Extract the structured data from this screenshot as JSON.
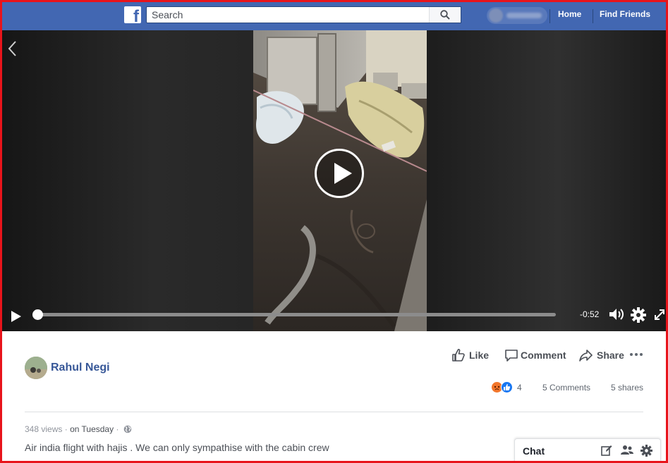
{
  "header": {
    "search_placeholder": "Search",
    "nav": {
      "home": "Home",
      "find_friends": "Find Friends"
    }
  },
  "video": {
    "time_remaining": "-0:52",
    "progress": 0
  },
  "post": {
    "author": "Rahul Negi",
    "actions": {
      "like": "Like",
      "comment": "Comment",
      "share": "Share"
    },
    "reactions_count": "4",
    "comments_count": "5 Comments",
    "shares_count": "5 shares",
    "views": "348 views",
    "date": "on Tuesday",
    "caption": "Air india flight with hajis . We can only sympathise with the cabin crew"
  },
  "chat": {
    "label": "Chat"
  },
  "colors": {
    "brand": "#4267b2",
    "link": "#385898",
    "frame_border": "#e8141b"
  }
}
